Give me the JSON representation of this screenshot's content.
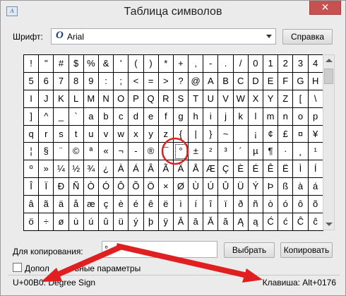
{
  "window": {
    "title": "Таблица символов",
    "close_glyph": "✕",
    "icon_glyph": "A"
  },
  "font": {
    "label": "Шрифт:",
    "icon_glyph": "O",
    "value": "Arial"
  },
  "buttons": {
    "help": "Справка",
    "select": "Выбрать",
    "copy": "Копировать"
  },
  "characters": [
    "!",
    "\"",
    "#",
    "$",
    "%",
    "&",
    "'",
    "(",
    ")",
    "*",
    "+",
    ",",
    "-",
    ".",
    "/",
    "0",
    "1",
    "2",
    "3",
    "4",
    "5",
    "6",
    "7",
    "8",
    "9",
    ":",
    ";",
    "<",
    "=",
    ">",
    "?",
    "@",
    "A",
    "B",
    "C",
    "D",
    "E",
    "F",
    "G",
    "H",
    "I",
    "J",
    "K",
    "L",
    "M",
    "N",
    "O",
    "P",
    "Q",
    "R",
    "S",
    "T",
    "U",
    "V",
    "W",
    "X",
    "Y",
    "Z",
    "[",
    "\\",
    "]",
    "^",
    "_",
    "`",
    "a",
    "b",
    "c",
    "d",
    "e",
    "f",
    "g",
    "h",
    "i",
    "j",
    "k",
    "l",
    "m",
    "n",
    "o",
    "p",
    "q",
    "r",
    "s",
    "t",
    "u",
    "v",
    "w",
    "x",
    "y",
    "z",
    "{",
    "|",
    "}",
    "~",
    " ",
    "¡",
    "¢",
    "£",
    "¤",
    "¥",
    "¦",
    "§",
    "¨",
    "©",
    "ª",
    "«",
    "¬",
    "-",
    "®",
    "¯",
    "°",
    "±",
    "²",
    "³",
    "´",
    "µ",
    "¶",
    "·",
    "¸",
    "¹",
    "º",
    "»",
    "¼",
    "½",
    "¾",
    "¿",
    "À",
    "Á",
    "Â",
    "Ã",
    "Ä",
    "Å",
    "Æ",
    "Ç",
    "È",
    "É",
    "Ê",
    "Ë",
    "Ì",
    "Í",
    "Î",
    "Ï",
    "Ð",
    "Ñ",
    "Ò",
    "Ó",
    "Ô",
    "Õ",
    "Ö",
    "×",
    "Ø",
    "Ù",
    "Ú",
    "Û",
    "Ü",
    "Ý",
    "Þ",
    "ß",
    "à",
    "á",
    "â",
    "ã",
    "ä",
    "å",
    "æ",
    "ç",
    "è",
    "é",
    "ê",
    "ë",
    "ì",
    "í",
    "î",
    "ï",
    "ð",
    "ñ",
    "ò",
    "ó",
    "ô",
    "õ",
    "ö",
    "÷",
    "ø",
    "ù",
    "ú",
    "û",
    "ü",
    "ý",
    "þ",
    "ÿ",
    "Ā",
    "ā",
    "Ă",
    "ă",
    "Ą",
    "ą",
    "Ć",
    "ć",
    "Ĉ",
    "ĉ"
  ],
  "selected_character": "°",
  "copy": {
    "label": "Для копирования:",
    "value": "°"
  },
  "advanced": {
    "label_part1": "Допол",
    "label_part2": "ьные параметры"
  },
  "status": {
    "left": "U+00B0: Degree Sign",
    "right": "Клавиша: Alt+0176"
  },
  "annotation_color": "#e02020"
}
